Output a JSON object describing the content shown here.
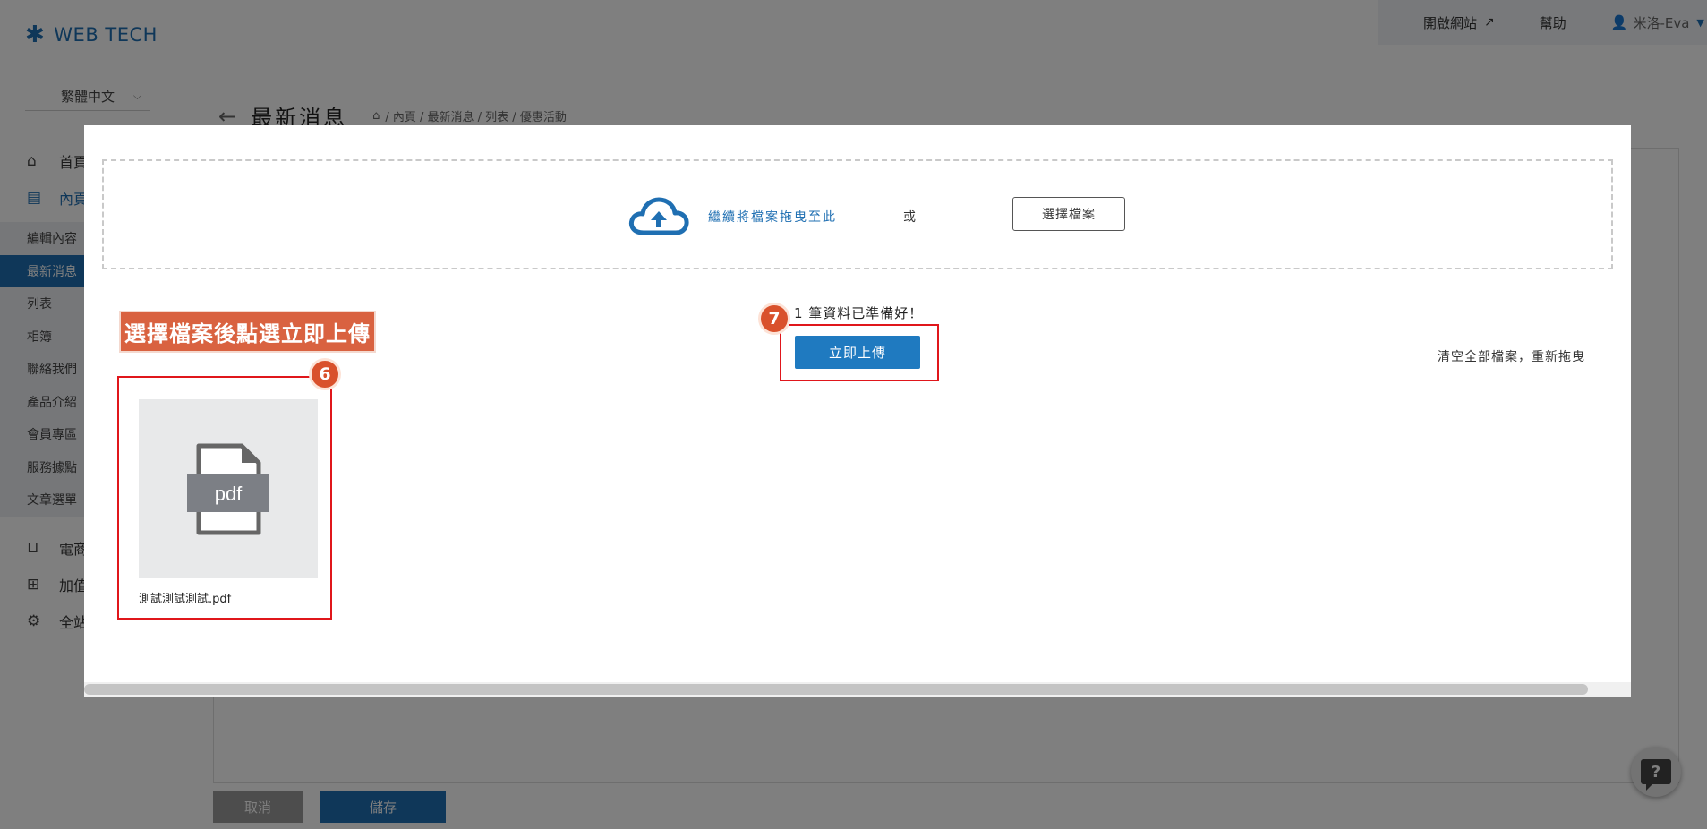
{
  "app": {
    "logo_text": "WEB TECH"
  },
  "language": {
    "selected": "繁體中文"
  },
  "topbar": {
    "open_site": "開啟網站",
    "help": "幫助",
    "user": "米洛-Eva"
  },
  "sidebar": {
    "main_items": [
      {
        "label": "首頁",
        "icon": "home-icon"
      },
      {
        "label": "內頁",
        "icon": "document-icon"
      }
    ],
    "sub_items": [
      {
        "label": "編輯內容"
      },
      {
        "label": "最新消息"
      },
      {
        "label": "列表"
      },
      {
        "label": "相簿"
      },
      {
        "label": "聯絡我們"
      },
      {
        "label": "產品介紹"
      },
      {
        "label": "會員專區"
      },
      {
        "label": "服務據點"
      },
      {
        "label": "文章選單"
      }
    ],
    "bottom_items": [
      {
        "label": "電商",
        "icon": "cart-icon"
      },
      {
        "label": "加值",
        "icon": "gift-icon"
      },
      {
        "label": "全站",
        "icon": "gear-icon"
      }
    ]
  },
  "page": {
    "title": "最新消息",
    "breadcrumb": "/ 內頁 / 最新消息 / 列表 / 優惠活動"
  },
  "footer_buttons": {
    "cancel": "取消",
    "save": "儲存"
  },
  "modal": {
    "dropzone_text": "繼續將檔案拖曳至此",
    "or_text": "或",
    "choose_file": "選擇檔案",
    "ready_text": "1 筆資料已準備好！",
    "upload_now": "立即上傳",
    "clear_all": "清空全部檔案，重新拖曳",
    "file": {
      "name": "測試測試測試.pdf",
      "type_label": "pdf"
    }
  },
  "annotations": {
    "instruction": "選擇檔案後點選立即上傳",
    "badge_file": "6",
    "badge_upload": "7"
  },
  "colors": {
    "brand": "#1f6fb2",
    "annotation_red": "#e0161b",
    "annotation_orange": "#d96240"
  }
}
